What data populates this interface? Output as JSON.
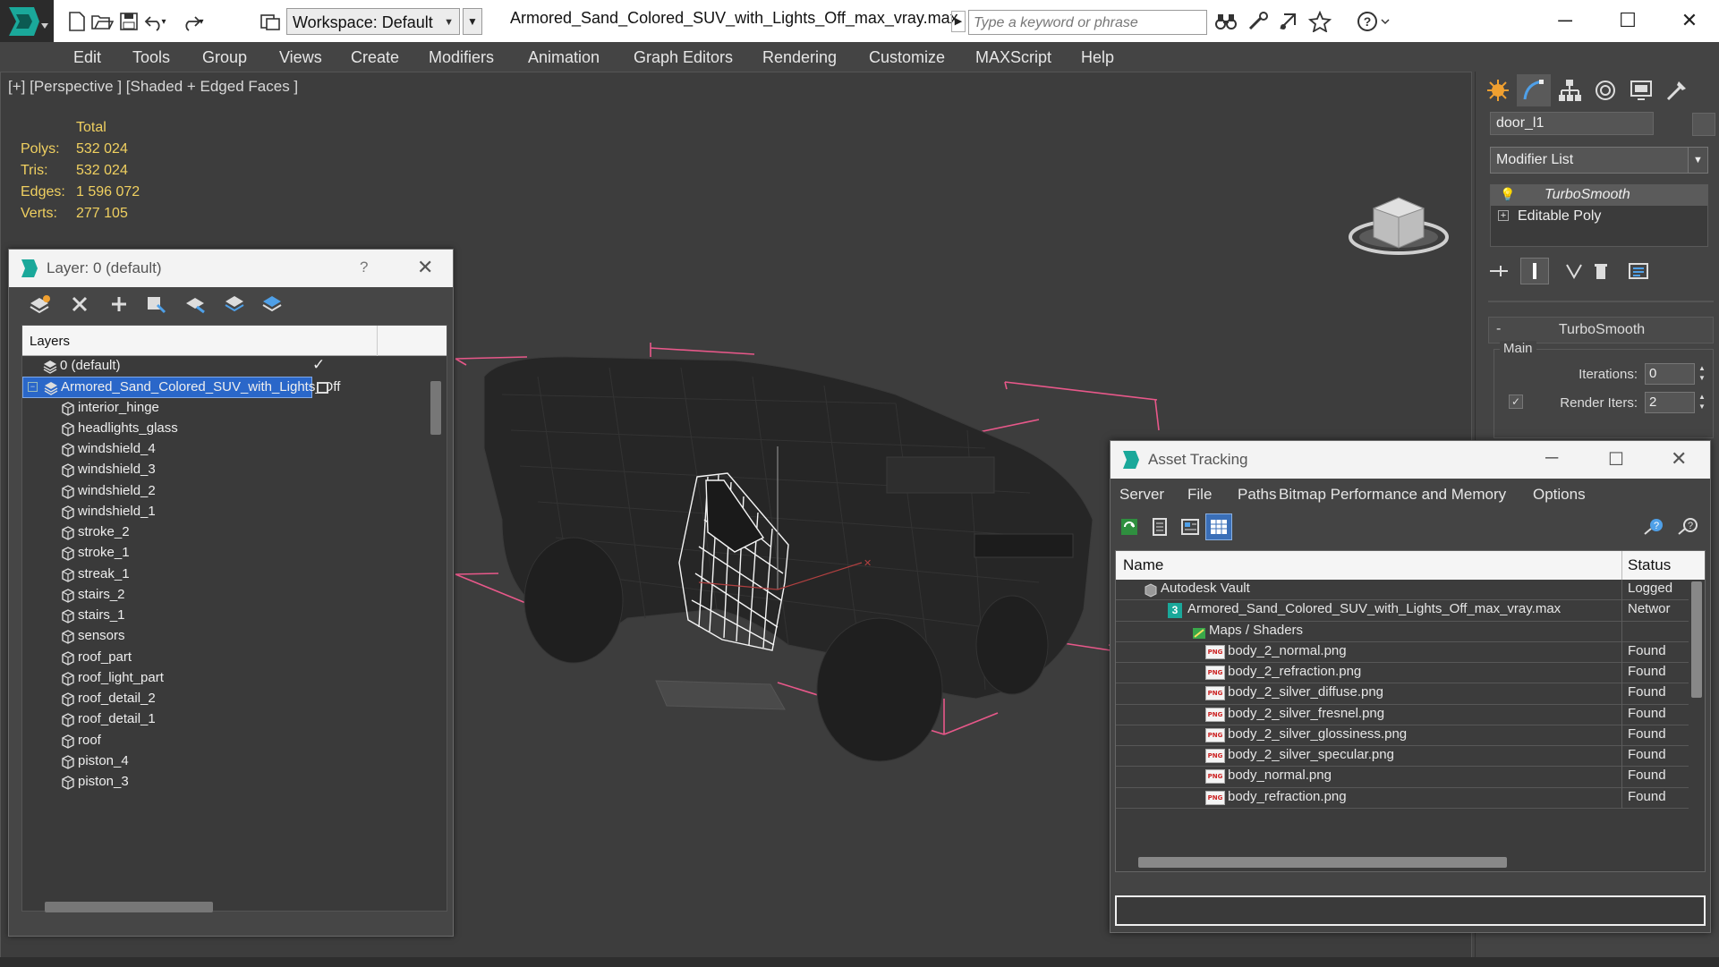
{
  "titlebar": {
    "workspace_label": "Workspace: Default",
    "file_title": "Armored_Sand_Colored_SUV_with_Lights_Off_max_vray.max",
    "search_placeholder": "Type a keyword or phrase",
    "help_icon": "?"
  },
  "menu": [
    "Edit",
    "Tools",
    "Group",
    "Views",
    "Create",
    "Modifiers",
    "Animation",
    "Graph Editors",
    "Rendering",
    "Customize",
    "MAXScript",
    "Help"
  ],
  "viewport": {
    "label": "[+] [Perspective ] [Shaded + Edged Faces ]",
    "stats": {
      "header": "Total",
      "rows": [
        {
          "label": "Polys:",
          "value": "532 024"
        },
        {
          "label": "Tris:",
          "value": "532 024"
        },
        {
          "label": "Edges:",
          "value": "1 596 072"
        },
        {
          "label": "Verts:",
          "value": "277 105"
        }
      ]
    },
    "stats_color": "#f0d060"
  },
  "command_panel": {
    "object_name": "door_l1",
    "modifier_list": "Modifier List",
    "stack": [
      {
        "label": "TurboSmooth",
        "selected": true
      },
      {
        "label": "Editable Poly",
        "selected": false
      }
    ],
    "rollout_title": "TurboSmooth",
    "rollout_minus": "-",
    "group_label": "Main",
    "iterations_label": "Iterations:",
    "iterations_value": "0",
    "render_iters_label": "Render Iters:",
    "render_iters_value": "2"
  },
  "layer_window": {
    "title": "Layer: 0 (default)",
    "help": "?",
    "header": "Layers",
    "layers": [
      {
        "name": "0 (default)",
        "type": "layer",
        "indent": 0,
        "selected": false,
        "current": true
      },
      {
        "name": "Armored_Sand_Colored_SUV_with_Lights_Off",
        "type": "layer",
        "indent": 0,
        "selected": true,
        "current": false
      },
      {
        "name": "interior_hinge",
        "type": "object",
        "indent": 1
      },
      {
        "name": "headlights_glass",
        "type": "object",
        "indent": 1
      },
      {
        "name": "windshield_4",
        "type": "object",
        "indent": 1
      },
      {
        "name": "windshield_3",
        "type": "object",
        "indent": 1
      },
      {
        "name": "windshield_2",
        "type": "object",
        "indent": 1
      },
      {
        "name": "windshield_1",
        "type": "object",
        "indent": 1
      },
      {
        "name": "stroke_2",
        "type": "object",
        "indent": 1
      },
      {
        "name": "stroke_1",
        "type": "object",
        "indent": 1
      },
      {
        "name": "streak_1",
        "type": "object",
        "indent": 1
      },
      {
        "name": "stairs_2",
        "type": "object",
        "indent": 1
      },
      {
        "name": "stairs_1",
        "type": "object",
        "indent": 1
      },
      {
        "name": "sensors",
        "type": "object",
        "indent": 1
      },
      {
        "name": "roof_part",
        "type": "object",
        "indent": 1
      },
      {
        "name": "roof_light_part",
        "type": "object",
        "indent": 1
      },
      {
        "name": "roof_detail_2",
        "type": "object",
        "indent": 1
      },
      {
        "name": "roof_detail_1",
        "type": "object",
        "indent": 1
      },
      {
        "name": "roof",
        "type": "object",
        "indent": 1
      },
      {
        "name": "piston_4",
        "type": "object",
        "indent": 1
      },
      {
        "name": "piston_3",
        "type": "object",
        "indent": 1
      }
    ]
  },
  "asset_window": {
    "title": "Asset Tracking",
    "menu": [
      "Server",
      "File",
      "Paths",
      "Bitmap Performance and Memory",
      "Options"
    ],
    "col_name": "Name",
    "col_status": "Status",
    "rows": [
      {
        "name": "Autodesk Vault",
        "status": "Logged",
        "kind": "vault"
      },
      {
        "name": "Armored_Sand_Colored_SUV_with_Lights_Off_max_vray.max",
        "status": "Networ",
        "kind": "max"
      },
      {
        "name": "Maps / Shaders",
        "status": "",
        "kind": "maps"
      },
      {
        "name": "body_2_normal.png",
        "status": "Found",
        "kind": "png"
      },
      {
        "name": "body_2_refraction.png",
        "status": "Found",
        "kind": "png"
      },
      {
        "name": "body_2_silver_diffuse.png",
        "status": "Found",
        "kind": "png"
      },
      {
        "name": "body_2_silver_fresnel.png",
        "status": "Found",
        "kind": "png"
      },
      {
        "name": "body_2_silver_glossiness.png",
        "status": "Found",
        "kind": "png"
      },
      {
        "name": "body_2_silver_specular.png",
        "status": "Found",
        "kind": "png"
      },
      {
        "name": "body_normal.png",
        "status": "Found",
        "kind": "png"
      },
      {
        "name": "body_refraction.png",
        "status": "Found",
        "kind": "png"
      }
    ],
    "png_icon_text": "PNG",
    "max_icon_text": "3"
  },
  "colors": {
    "accent_blue": "#1e6fd9",
    "selection_blue": "#2a67c9",
    "bbox_pink": "#e8588a"
  }
}
